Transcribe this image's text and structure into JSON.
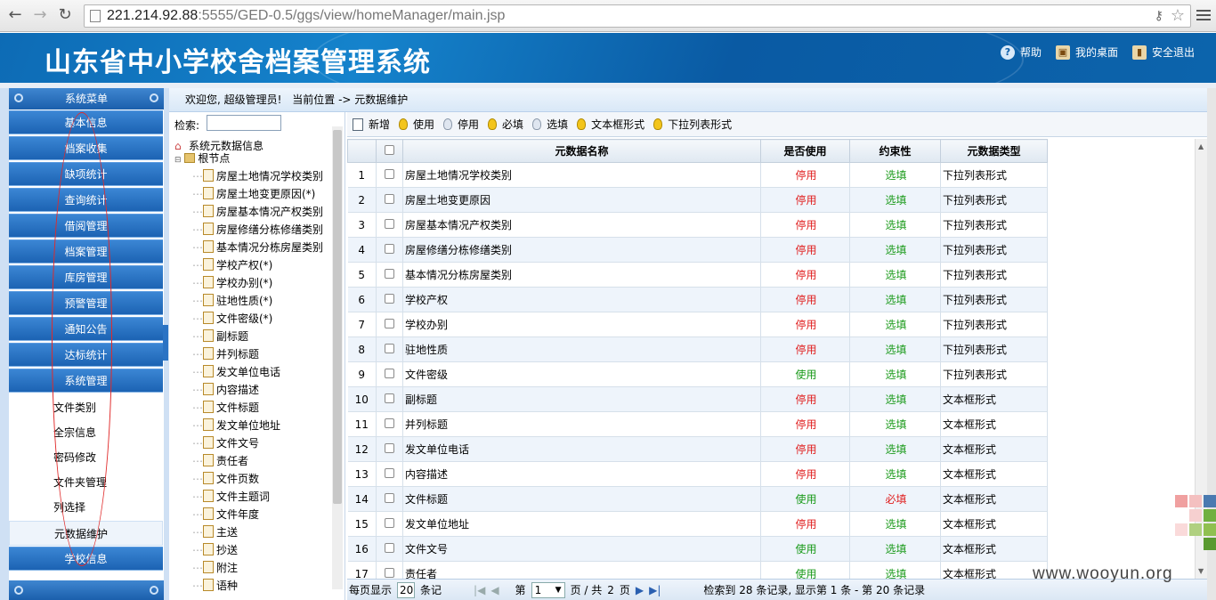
{
  "browser": {
    "url_host": "221.214.92.88",
    "url_rest": ":5555/GED-0.5/ggs/view/homeManager/main.jsp"
  },
  "header": {
    "title": "山东省中小学校舍档案管理系统",
    "links": [
      "帮助",
      "我的桌面",
      "安全退出"
    ]
  },
  "sidebar": {
    "title": "系统菜单",
    "menu": [
      "基本信息",
      "档案收集",
      "缺项统计",
      "查询统计",
      "借阅管理",
      "档案管理",
      "库房管理",
      "预警管理",
      "通知公告",
      "达标统计",
      "系统管理"
    ],
    "sub_items": [
      "文件类别",
      "全宗信息",
      "密码修改",
      "文件夹管理",
      "列选择",
      "元数据维护"
    ],
    "active_sub": "元数据维护",
    "bottom_menu": "学校信息"
  },
  "breadcrumb": {
    "welcome": "欢迎您,  超级管理员!",
    "location": "当前位置 -> 元数据维护"
  },
  "tree": {
    "search_label": "检索:",
    "root": "系统元数据信息",
    "node": "根节点",
    "items": [
      "房屋土地情况学校类别",
      "房屋土地变更原因(*)",
      "房屋基本情况产权类别",
      "房屋修缮分栋修缮类别",
      "基本情况分栋房屋类别",
      "学校产权(*)",
      "学校办别(*)",
      "驻地性质(*)",
      "文件密级(*)",
      "副标题",
      "并列标题",
      "发文单位电话",
      "内容描述",
      "文件标题",
      "发文单位地址",
      "文件文号",
      "责任者",
      "文件页数",
      "文件主题词",
      "文件年度",
      "主送",
      "抄送",
      "附注",
      "语种"
    ]
  },
  "toolbar": {
    "new": "新增",
    "use": "使用",
    "disable": "停用",
    "required": "必填",
    "optional": "选填",
    "textbox": "文本框形式",
    "dropdown": "下拉列表形式"
  },
  "table": {
    "headers": [
      "元数据名称",
      "是否使用",
      "约束性",
      "元数据类型"
    ],
    "rows": [
      {
        "n": "1",
        "name": "房屋土地情况学校类别",
        "use": "停用",
        "req": "选填",
        "type": "下拉列表形式"
      },
      {
        "n": "2",
        "name": "房屋土地变更原因",
        "use": "停用",
        "req": "选填",
        "type": "下拉列表形式"
      },
      {
        "n": "3",
        "name": "房屋基本情况产权类别",
        "use": "停用",
        "req": "选填",
        "type": "下拉列表形式"
      },
      {
        "n": "4",
        "name": "房屋修缮分栋修缮类别",
        "use": "停用",
        "req": "选填",
        "type": "下拉列表形式"
      },
      {
        "n": "5",
        "name": "基本情况分栋房屋类别",
        "use": "停用",
        "req": "选填",
        "type": "下拉列表形式"
      },
      {
        "n": "6",
        "name": "学校产权",
        "use": "停用",
        "req": "选填",
        "type": "下拉列表形式"
      },
      {
        "n": "7",
        "name": "学校办别",
        "use": "停用",
        "req": "选填",
        "type": "下拉列表形式"
      },
      {
        "n": "8",
        "name": "驻地性质",
        "use": "停用",
        "req": "选填",
        "type": "下拉列表形式"
      },
      {
        "n": "9",
        "name": "文件密级",
        "use": "使用",
        "req": "选填",
        "type": "下拉列表形式"
      },
      {
        "n": "10",
        "name": "副标题",
        "use": "停用",
        "req": "选填",
        "type": "文本框形式"
      },
      {
        "n": "11",
        "name": "并列标题",
        "use": "停用",
        "req": "选填",
        "type": "文本框形式"
      },
      {
        "n": "12",
        "name": "发文单位电话",
        "use": "停用",
        "req": "选填",
        "type": "文本框形式"
      },
      {
        "n": "13",
        "name": "内容描述",
        "use": "停用",
        "req": "选填",
        "type": "文本框形式"
      },
      {
        "n": "14",
        "name": "文件标题",
        "use": "使用",
        "req": "必填",
        "type": "文本框形式"
      },
      {
        "n": "15",
        "name": "发文单位地址",
        "use": "停用",
        "req": "选填",
        "type": "文本框形式"
      },
      {
        "n": "16",
        "name": "文件文号",
        "use": "使用",
        "req": "选填",
        "type": "文本框形式"
      },
      {
        "n": "17",
        "name": "责任者",
        "use": "使用",
        "req": "选填",
        "type": "文本框形式"
      }
    ]
  },
  "pager": {
    "per_page_label": "每页显示",
    "per_page": "20",
    "per_page_unit": "条记",
    "page_label": "第",
    "page": "1",
    "page_total_label": "页 / 共",
    "pages": "2",
    "page_unit": "页",
    "summary": "检索到  28  条记录, 显示第  1  条  -  第  20  条记录"
  },
  "watermark": "www.wooyun.org",
  "colors": {
    "header_blue": "#0d6bb5",
    "use_green": "#1a9a1a",
    "stop_red": "#e02020"
  }
}
